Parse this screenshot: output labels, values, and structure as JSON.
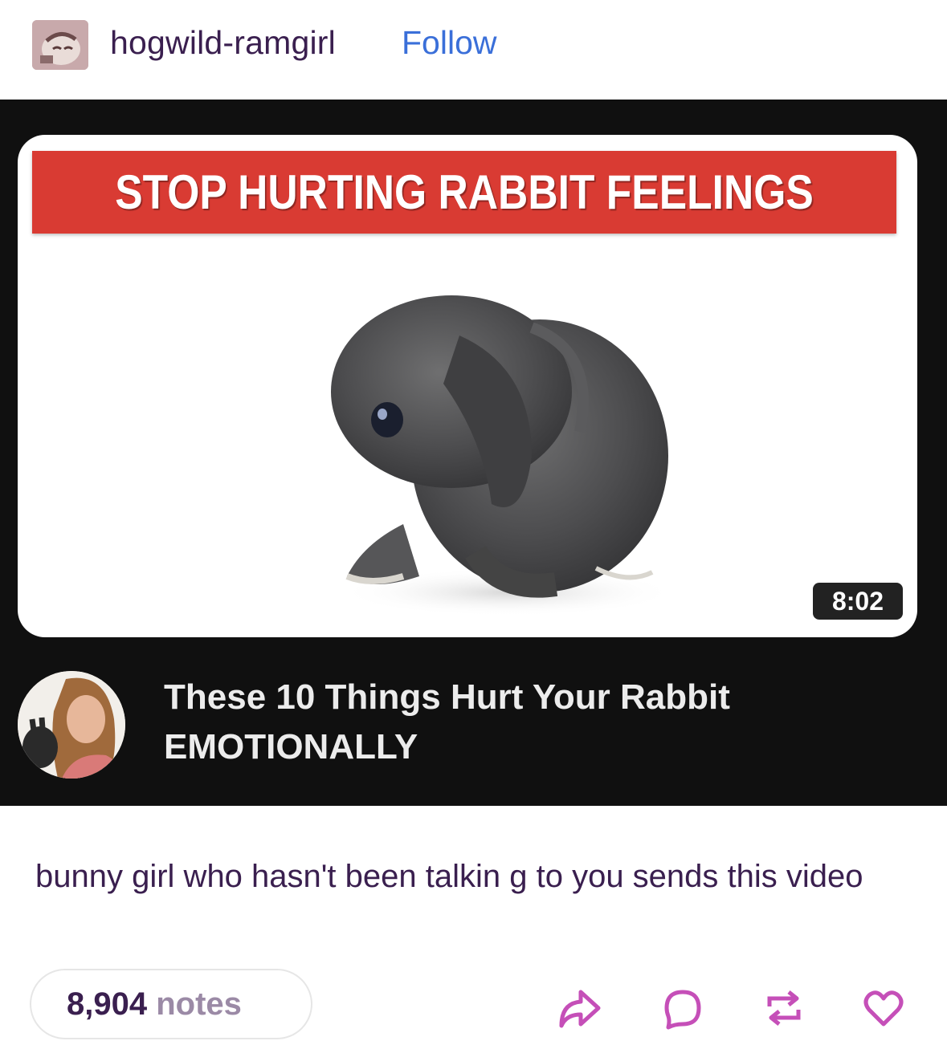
{
  "post": {
    "username": "hogwild-ramgirl",
    "follow_label": "Follow",
    "caption": "bunny girl who hasn't been talkin g to you sends this video",
    "notes_count": "8,904",
    "notes_word": "notes"
  },
  "video": {
    "banner_text": "STOP HURTING RABBIT FEELINGS",
    "duration": "8:02",
    "title_line1": "These 10 Things Hurt Your Rabbit",
    "title_line2": "EMOTIONALLY"
  },
  "colors": {
    "username": "#3a1f4f",
    "follow": "#3a6fd9",
    "banner": "#d93b33",
    "actions": "#c54fb8"
  },
  "icons": [
    "share-icon",
    "reply-icon",
    "reblog-icon",
    "like-icon"
  ]
}
